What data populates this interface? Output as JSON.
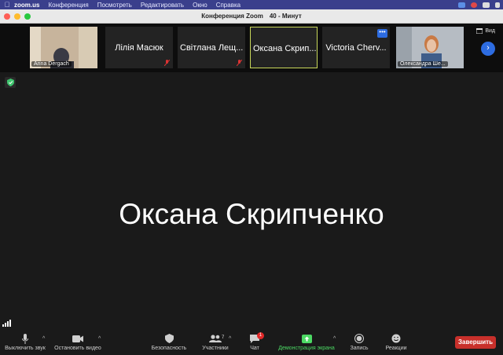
{
  "menubar": {
    "app": "zoom.us",
    "items": [
      "Конференция",
      "Посмотреть",
      "Редактировать",
      "Окно",
      "Справка"
    ]
  },
  "window": {
    "title": "Конференция Zoom",
    "timer": "40 - Минут"
  },
  "strip": {
    "tiles": [
      {
        "label": "Anna Dergach"
      },
      {
        "name": "Лілія Масюк"
      },
      {
        "name": "Світлана Лещ..."
      },
      {
        "name": "Оксана Скрип..."
      },
      {
        "name": "Victoria Cherv..."
      },
      {
        "label": "Олександра Ше..."
      }
    ],
    "view_label": "Вид",
    "next_icon": "chevron-right-icon"
  },
  "stage": {
    "speaker_name": "Оксана Скрипченко"
  },
  "toolbar": {
    "mute_label": "Выключить звук",
    "video_label": "Остановить видео",
    "security_label": "Безопасность",
    "participants_label": "Участники",
    "participants_count": "7",
    "chat_label": "Чат",
    "chat_badge": "1",
    "share_label": "Демонстрация экрана",
    "record_label": "Запись",
    "reactions_label": "Реакции",
    "end_label": "Завершить"
  },
  "colors": {
    "menubar": "#3a3f8c",
    "accent_blue": "#2d6ce1",
    "active_border": "#c9d85a",
    "share_green": "#4cd964",
    "end_red": "#c8302b"
  }
}
